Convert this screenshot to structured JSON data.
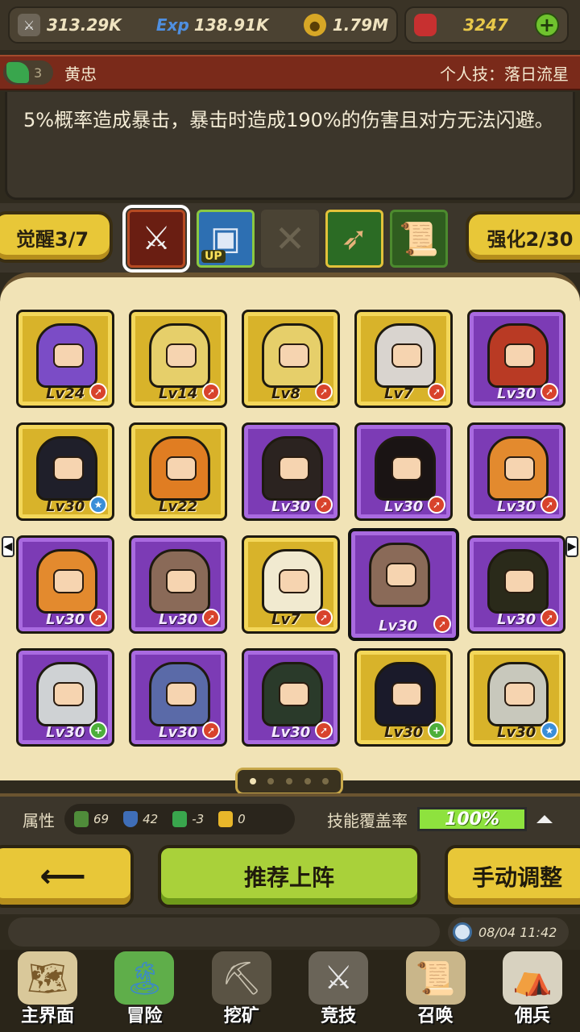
{
  "resources": {
    "attack": "313.29K",
    "exp_icon_label": "Exp",
    "exp": "138.91K",
    "gold": "1.79M",
    "gems": "3247"
  },
  "skill": {
    "badge_count": "3",
    "hero_name": "黄忠",
    "title": "个人技：落日流星",
    "description": "5%概率造成暴击，暴击时造成190%的伤害且对方无法闪避。"
  },
  "tabs": {
    "awaken": "觉醒3/7",
    "enhance": "强化2/30",
    "up_tag": "UP"
  },
  "heroes": [
    {
      "level": "Lv24",
      "frame": "gold",
      "hair": "#7b4cc6",
      "status": "arrow"
    },
    {
      "level": "Lv14",
      "frame": "gold",
      "hair": "#e6cf6a",
      "status": "arrow"
    },
    {
      "level": "Lv8",
      "frame": "gold",
      "hair": "#e6cf6a",
      "status": "arrow"
    },
    {
      "level": "Lv7",
      "frame": "gold",
      "hair": "#d9d4cf",
      "status": "arrow"
    },
    {
      "level": "Lv30",
      "frame": "purple",
      "hair": "#b93a24",
      "status": "arrow"
    },
    {
      "level": "Lv30",
      "frame": "gold",
      "hair": "#1f1f2a",
      "status": "star"
    },
    {
      "level": "Lv22",
      "frame": "gold",
      "hair": "#e07d22",
      "status": "none"
    },
    {
      "level": "Lv30",
      "frame": "purple",
      "hair": "#2b2320",
      "status": "arrow"
    },
    {
      "level": "Lv30",
      "frame": "purple",
      "hair": "#1a1414",
      "status": "arrow"
    },
    {
      "level": "Lv30",
      "frame": "purple",
      "hair": "#e38a2e",
      "status": "arrow"
    },
    {
      "level": "Lv30",
      "frame": "purple",
      "hair": "#e38a2e",
      "status": "arrow"
    },
    {
      "level": "Lv30",
      "frame": "purple",
      "hair": "#8a6a58",
      "status": "arrow"
    },
    {
      "level": "Lv7",
      "frame": "gold",
      "hair": "#f1ead0",
      "status": "arrow"
    },
    {
      "level": "Lv30",
      "frame": "purple",
      "hair": "#8a6a58",
      "status": "arrow",
      "selected": true
    },
    {
      "level": "Lv30",
      "frame": "purple",
      "hair": "#2a2a1a",
      "status": "arrow"
    },
    {
      "level": "Lv30",
      "frame": "purple",
      "hair": "#cfd2d4",
      "status": "plus"
    },
    {
      "level": "Lv30",
      "frame": "purple",
      "hair": "#5a6aa8",
      "status": "arrow"
    },
    {
      "level": "Lv30",
      "frame": "purple",
      "hair": "#2a3a2a",
      "status": "arrow"
    },
    {
      "level": "Lv30",
      "frame": "gold",
      "hair": "#1a1a2a",
      "status": "plus"
    },
    {
      "level": "Lv30",
      "frame": "gold",
      "hair": "#c8c8bc",
      "status": "star"
    }
  ],
  "pager": {
    "current": 1,
    "total": 5
  },
  "stats": {
    "label": "属性",
    "leaf": "69",
    "shield": "42",
    "gem": "-3",
    "crown": "0",
    "coverage_label": "技能覆盖率",
    "coverage": "100%"
  },
  "buttons": {
    "back": "⟵",
    "recommend": "推荐上阵",
    "manual": "手动调整"
  },
  "time": "08/04 11:42",
  "nav": [
    {
      "label": "主界面",
      "icon": "map-scroll-icon"
    },
    {
      "label": "冒险",
      "icon": "island-icon"
    },
    {
      "label": "挖矿",
      "icon": "pickaxe-icon"
    },
    {
      "label": "竞技",
      "icon": "crossed-swords-icon"
    },
    {
      "label": "召唤",
      "icon": "summon-scroll-icon"
    },
    {
      "label": "佣兵",
      "icon": "tent-icon"
    }
  ],
  "colors": {
    "gold_frame": "#d8b32a",
    "purple_frame": "#7c3bb5",
    "accent_yellow": "#e8c738",
    "accent_green": "#a9d13a",
    "skill_header": "#7a2a1a"
  }
}
